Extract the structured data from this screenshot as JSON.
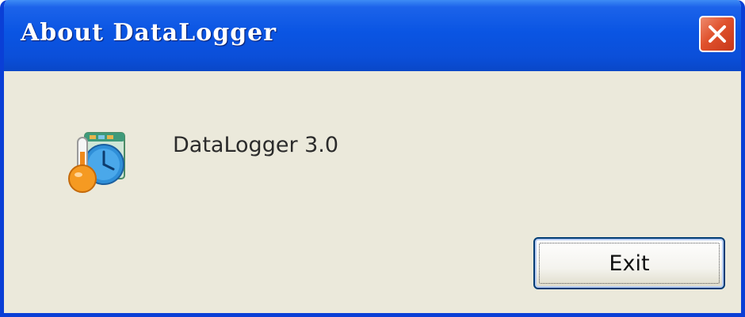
{
  "window": {
    "title": "About DataLogger",
    "colors": {
      "titlebar": "#0a55e3",
      "frame": "#0a3fd6",
      "body": "#ebe9db",
      "close_button": "#e0512c"
    }
  },
  "titlebar": {
    "close_icon": "close-x-icon"
  },
  "content": {
    "app_icon": "datalogger-app-icon",
    "app_name": "DataLogger 3.0"
  },
  "buttons": {
    "exit_label": "Exit"
  }
}
